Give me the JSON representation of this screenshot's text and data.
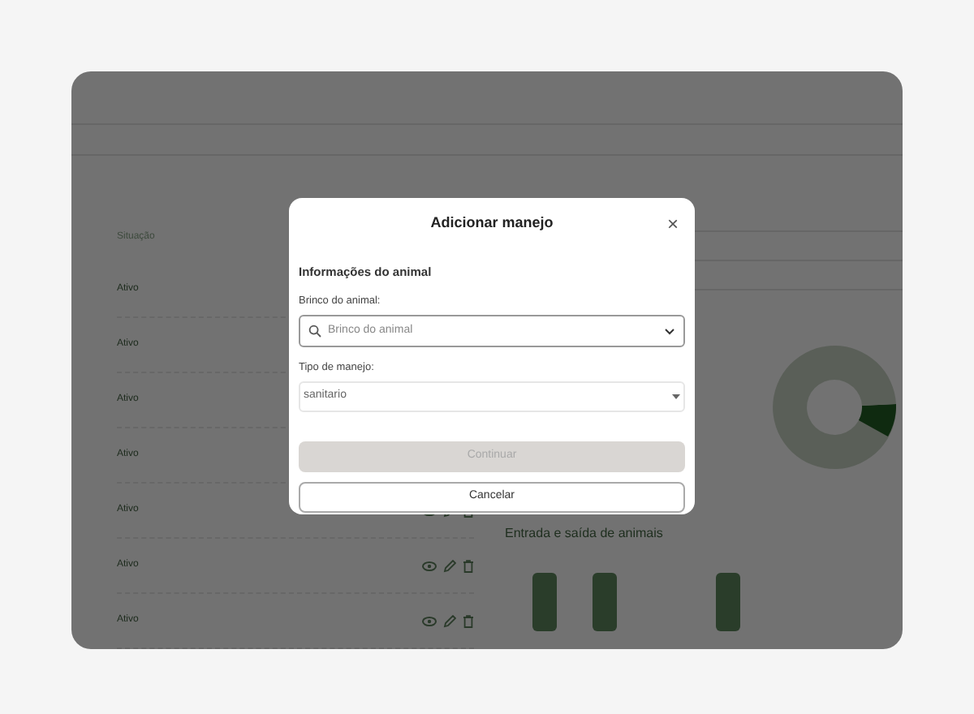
{
  "table": {
    "header": "Situação",
    "rows": [
      {
        "status": "Ativo"
      },
      {
        "status": "Ativo"
      },
      {
        "status": "Ativo"
      },
      {
        "status": "Ativo"
      },
      {
        "status": "Ativo",
        "actions": true
      },
      {
        "status": "Ativo",
        "actions": true
      },
      {
        "status": "Ativo",
        "actions": true
      }
    ]
  },
  "bar_chart": {
    "title": "Entrada e saída de animais"
  },
  "modal": {
    "title": "Adicionar manejo",
    "close": "×",
    "section": "Informações do animal",
    "fields": [
      {
        "kind": "search",
        "label": "Brinco do animal:",
        "placeholder": "Brinco do animal"
      },
      {
        "kind": "select",
        "label": "Tipo de manejo:",
        "value": "sanitario"
      }
    ],
    "buttons": [
      {
        "label": "Continuar",
        "disabled": true
      },
      {
        "label": "Cancelar",
        "disabled": false
      }
    ]
  }
}
